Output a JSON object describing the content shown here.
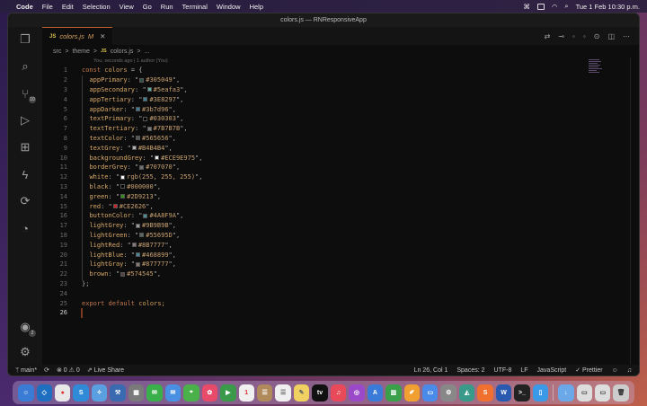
{
  "menubar": {
    "app_name": "Code",
    "items": [
      "File",
      "Edit",
      "Selection",
      "View",
      "Go",
      "Run",
      "Terminal",
      "Window",
      "Help"
    ],
    "clock": "Tue 1 Feb  10:30 p.m."
  },
  "window": {
    "title": "colors.js — RNResponsiveApp"
  },
  "tab": {
    "js": "JS",
    "label": "colors.js",
    "modified": "M",
    "close": "✕"
  },
  "breadcrumb": {
    "src": "src",
    "sep1": ">",
    "theme": "theme",
    "sep2": ">",
    "js": "JS",
    "file": "colors.js",
    "sep3": ">",
    "more": "..."
  },
  "blame": "You, seconds ago | 1 author (You)",
  "code": {
    "decl_kw": "const",
    "decl_name": "colors",
    "decl_rest": " = {",
    "entries": [
      {
        "key": "appPrimary",
        "value": "#305049",
        "swatch": "#305049"
      },
      {
        "key": "appSecondary",
        "value": "#5eafa3",
        "swatch": "#5eafa3"
      },
      {
        "key": "appTertiary",
        "value": "#3E8297",
        "swatch": "#3E8297"
      },
      {
        "key": "appDarker",
        "value": "#3b7d96",
        "swatch": "#3b7d96"
      },
      {
        "key": "textPrimary",
        "value": "#030303",
        "swatch": "#030303"
      },
      {
        "key": "textTertiary",
        "value": "#7B7B7B",
        "swatch": "#7B7B7B"
      },
      {
        "key": "textColor",
        "value": "#565656",
        "swatch": "#565656"
      },
      {
        "key": "textGrey",
        "value": "#B4B4B4",
        "swatch": "#B4B4B4"
      },
      {
        "key": "backgroundGrey",
        "value": "#ECE9E975",
        "swatch": "#ECE9E9"
      },
      {
        "key": "borderGrey",
        "value": "#707070",
        "swatch": "#707070"
      },
      {
        "key": "white",
        "value": "rgb(255, 255, 255)",
        "swatch": "#ffffff"
      },
      {
        "key": "black",
        "value": "#000000",
        "swatch": "#000000"
      },
      {
        "key": "green",
        "value": "#2D9213",
        "swatch": "#2D9213"
      },
      {
        "key": "red",
        "value": "#CE2626",
        "swatch": "#CE2626"
      },
      {
        "key": "buttonColor",
        "value": "#4A8F9A",
        "swatch": "#4A8F9A"
      },
      {
        "key": "lightGrey",
        "value": "#9B9B9B",
        "swatch": "#9B9B9B"
      },
      {
        "key": "lightGreen",
        "value": "#55695D",
        "swatch": "#55695D"
      },
      {
        "key": "lightRed",
        "value": "#8B7777",
        "swatch": "#8B7777"
      },
      {
        "key": "lightBlue",
        "value": "#468899",
        "swatch": "#468899"
      },
      {
        "key": "lightGray",
        "value": "#877777",
        "swatch": "#877777"
      },
      {
        "key": "brown",
        "value": "#574545",
        "swatch": "#574545"
      }
    ],
    "close": "};",
    "export_kw1": "export",
    "export_kw2": "default",
    "export_rest": " colors;",
    "line_numbers": [
      "1",
      "2",
      "3",
      "4",
      "5",
      "6",
      "7",
      "8",
      "9",
      "10",
      "11",
      "12",
      "13",
      "14",
      "15",
      "16",
      "17",
      "18",
      "19",
      "20",
      "21",
      "22",
      "23",
      "24",
      "25",
      "26"
    ]
  },
  "status": {
    "branch": "main*",
    "sync": "⟳",
    "errors": "0",
    "warnings": "0",
    "live_share": "Live Share",
    "position": "Ln 26, Col 1",
    "spaces": "Spaces: 2",
    "encoding": "UTF-8",
    "eol": "LF",
    "language": "JavaScript",
    "prettier": "✓ Prettier"
  },
  "activity_badges": {
    "source_control": "10",
    "accounts": "2"
  },
  "colors": {
    "accent": "#c06030",
    "editor_bg": "#0d0d0d"
  }
}
